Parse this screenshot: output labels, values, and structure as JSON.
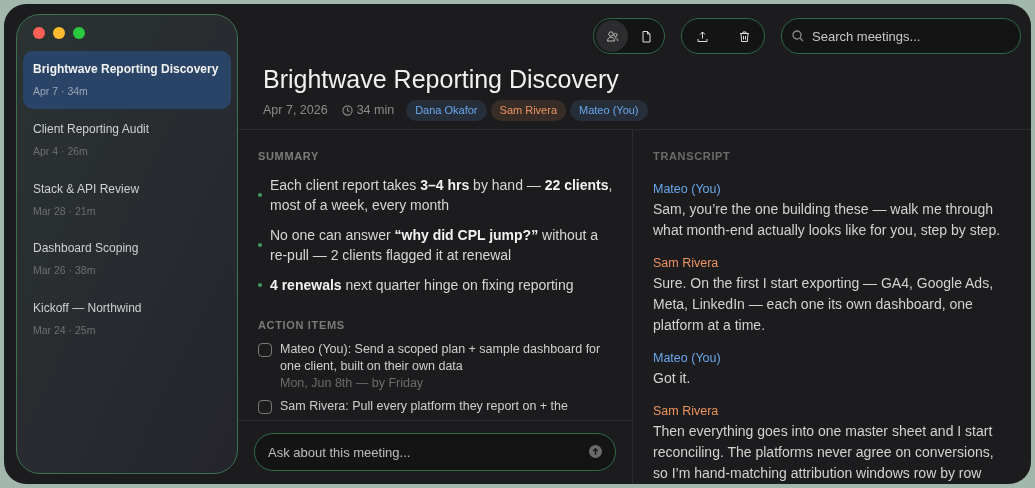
{
  "sidebar": {
    "items": [
      {
        "title": "Brightwave Reporting Discovery",
        "meta": "Apr 7 · 34m",
        "selected": true
      },
      {
        "title": "Client Reporting Audit",
        "meta": "Apr 4 · 26m",
        "selected": false
      },
      {
        "title": "Stack & API Review",
        "meta": "Mar 28 · 21m",
        "selected": false
      },
      {
        "title": "Dashboard Scoping",
        "meta": "Mar 26 · 38m",
        "selected": false
      },
      {
        "title": "Kickoff — Northwind",
        "meta": "Mar 24 · 25m",
        "selected": false
      }
    ]
  },
  "toolbar": {
    "views": [
      {
        "kind": "people",
        "selected": true
      },
      {
        "kind": "document",
        "selected": false
      }
    ],
    "actions": [
      {
        "kind": "upload"
      },
      {
        "kind": "trash"
      }
    ]
  },
  "search": {
    "placeholder": "Search meetings..."
  },
  "meeting": {
    "title": "Brightwave Reporting Discovery",
    "date": "Apr 7, 2026",
    "duration": "34 min",
    "participants": [
      {
        "name": "Dana Okafor",
        "color": "#6aa8ee"
      },
      {
        "name": "Sam Rivera",
        "color": "#ee9460"
      },
      {
        "name": "Mateo (You)",
        "color": "#6aa8ee"
      }
    ]
  },
  "summary": {
    "heading": "SUMMARY",
    "bullets": [
      "Each client report takes **3–4 hrs** by hand — **22 clients**, most of a week, every month",
      "No one can answer **“why did CPL jump?”** without a re-pull — 2 clients flagged it at renewal",
      "**4 renewals** next quarter hinge on fixing reporting"
    ]
  },
  "action_items": {
    "heading": "ACTION ITEMS",
    "items": [
      {
        "text": "Mateo (You): Send a scoped plan + sample dashboard for one client, built on their own data",
        "due": "Mon, Jun 8th — by Friday",
        "checked": false
      },
      {
        "text": "Sam Rivera: Pull every platform they report on + the",
        "checked": false
      }
    ]
  },
  "ask": {
    "placeholder": "Ask about this meeting..."
  },
  "transcript": {
    "heading": "TRANSCRIPT",
    "entries": [
      {
        "speaker": "Mateo (You)",
        "color": "#6aa8ee",
        "text": "Sam, you’re the one building these — walk me through what month-end actually looks like for you, step by step."
      },
      {
        "speaker": "Sam Rivera",
        "color": "#ee9460",
        "text": "Sure. On the first I start exporting — GA4, Google Ads, Meta, LinkedIn — each one its own dashboard, one platform at a time."
      },
      {
        "speaker": "Mateo (You)",
        "color": "#6aa8ee",
        "text": "Got it."
      },
      {
        "speaker": "Sam Rivera",
        "color": "#ee9460",
        "text": "Then everything goes into one master sheet and I start reconciling. The platforms never agree on conversions, so I’m hand-matching attribution windows row by row"
      }
    ]
  }
}
